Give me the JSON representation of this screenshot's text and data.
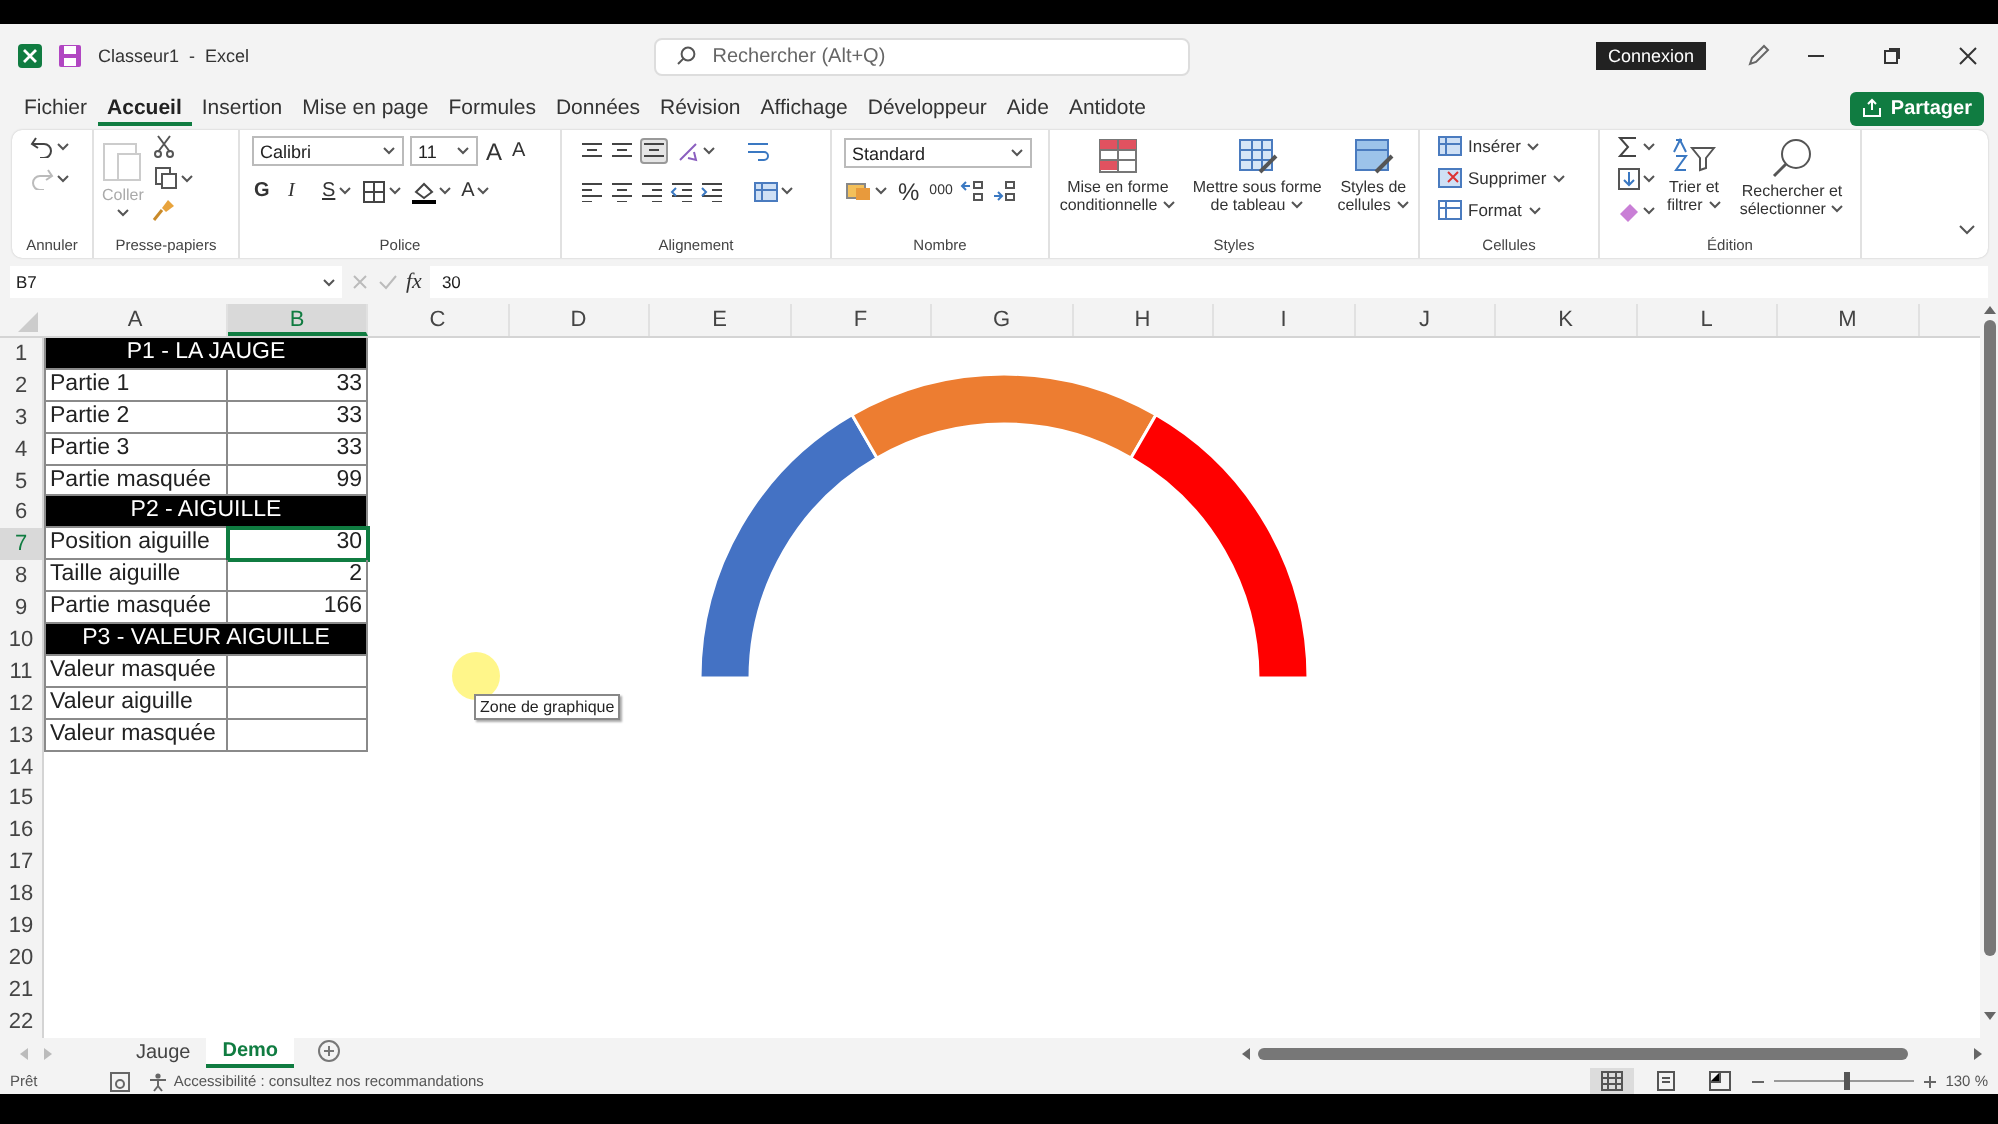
{
  "window": {
    "title": "Classeur1  -  Excel",
    "search_placeholder": "Rechercher (Alt+Q)",
    "signin": "Connexion"
  },
  "menu": [
    {
      "label": "Fichier",
      "selected": false
    },
    {
      "label": "Accueil",
      "selected": true
    },
    {
      "label": "Insertion",
      "selected": false
    },
    {
      "label": "Mise en page",
      "selected": false
    },
    {
      "label": "Formules",
      "selected": false
    },
    {
      "label": "Données",
      "selected": false
    },
    {
      "label": "Révision",
      "selected": false
    },
    {
      "label": "Affichage",
      "selected": false
    },
    {
      "label": "Développeur",
      "selected": false
    },
    {
      "label": "Aide",
      "selected": false
    },
    {
      "label": "Antidote",
      "selected": false
    }
  ],
  "share": "Partager",
  "ribbon": {
    "undo": {
      "label": "Annuler"
    },
    "clipboard": {
      "paste": {
        "label": "Coller",
        "disabled": true
      },
      "label": "Presse-papiers"
    },
    "font": {
      "name": "Calibri",
      "size": "11",
      "grow": "A",
      "shrink": "A",
      "bold": "G",
      "italic": "I",
      "underline": "S",
      "font_color": "A",
      "label": "Police"
    },
    "alignment": {
      "label": "Alignement"
    },
    "number": {
      "format": "Standard",
      "percent": "%",
      "thousands": "000",
      "label": "Nombre"
    },
    "styles": {
      "buttons": [
        "Mise en forme conditionnelle",
        "Mettre sous forme de tableau",
        "Styles de cellules"
      ],
      "label": "Styles"
    },
    "cells": {
      "buttons": [
        "Insérer",
        "Supprimer",
        "Format"
      ],
      "label": "Cellules"
    },
    "editing": {
      "buttons": [
        "Trier et filtrer",
        "Rechercher et sélectionner"
      ],
      "label": "Édition"
    }
  },
  "formula_bar": {
    "name_box": "B7",
    "fx": "fx",
    "value": "30"
  },
  "sheet": {
    "columns": [
      {
        "label": "A",
        "selected": false
      },
      {
        "label": "B",
        "selected": true
      },
      {
        "label": "C",
        "selected": false
      },
      {
        "label": "D",
        "selected": false
      },
      {
        "label": "E",
        "selected": false
      },
      {
        "label": "F",
        "selected": false
      },
      {
        "label": "G",
        "selected": false
      },
      {
        "label": "H",
        "selected": false
      },
      {
        "label": "I",
        "selected": false
      },
      {
        "label": "J",
        "selected": false
      },
      {
        "label": "K",
        "selected": false
      },
      {
        "label": "L",
        "selected": false
      },
      {
        "label": "M",
        "selected": false
      }
    ],
    "rows": [
      {
        "number": "1",
        "kind": "header",
        "a": "P1 - LA JAUGE",
        "selected": false
      },
      {
        "number": "2",
        "kind": "data",
        "a": "Partie 1",
        "b": "33",
        "selected": false
      },
      {
        "number": "3",
        "kind": "data",
        "a": "Partie 2",
        "b": "33",
        "selected": false
      },
      {
        "number": "4",
        "kind": "data",
        "a": "Partie 3",
        "b": "33",
        "selected": false
      },
      {
        "number": "5",
        "kind": "data",
        "a": "Partie masquée",
        "b": "99",
        "selected": false
      },
      {
        "number": "6",
        "kind": "header",
        "a": "P2 - AIGUILLE",
        "selected": false
      },
      {
        "number": "7",
        "kind": "data",
        "a": "Position aiguille",
        "b": "30",
        "selected": true
      },
      {
        "number": "8",
        "kind": "data",
        "a": "Taille aiguille",
        "b": "2",
        "selected": false
      },
      {
        "number": "9",
        "kind": "data",
        "a": "Partie masquée",
        "b": "166",
        "selected": false
      },
      {
        "number": "10",
        "kind": "header",
        "a": "P3 - VALEUR AIGUILLE",
        "selected": false
      },
      {
        "number": "11",
        "kind": "data",
        "a": "Valeur masquée",
        "selected": false
      },
      {
        "number": "12",
        "kind": "data",
        "a": "Valeur aiguille",
        "selected": false
      },
      {
        "number": "13",
        "kind": "data",
        "a": "Valeur masquée",
        "selected": false
      },
      {
        "number": "14",
        "kind": "empty",
        "selected": false
      },
      {
        "number": "15",
        "kind": "empty",
        "selected": false
      },
      {
        "number": "16",
        "kind": "empty",
        "selected": false
      },
      {
        "number": "17",
        "kind": "empty",
        "selected": false
      },
      {
        "number": "18",
        "kind": "empty",
        "selected": false
      },
      {
        "number": "19",
        "kind": "empty",
        "selected": false
      },
      {
        "number": "20",
        "kind": "empty",
        "selected": false
      },
      {
        "number": "21",
        "kind": "empty",
        "selected": false
      },
      {
        "number": "22",
        "kind": "empty",
        "selected": false
      }
    ],
    "tooltip": "Zone de graphique"
  },
  "sheet_tabs": [
    {
      "label": "Jauge",
      "selected": false
    },
    {
      "label": "Demo",
      "selected": true
    }
  ],
  "status_bar": {
    "ready": "Prêt",
    "accessibility": "Accessibilité : consultez nos recommandations",
    "views": [
      {
        "selected": true
      },
      {
        "selected": false
      },
      {
        "selected": false
      }
    ],
    "zoom_slider": {
      "level": 0.5
    },
    "zoom": "130 %"
  }
}
